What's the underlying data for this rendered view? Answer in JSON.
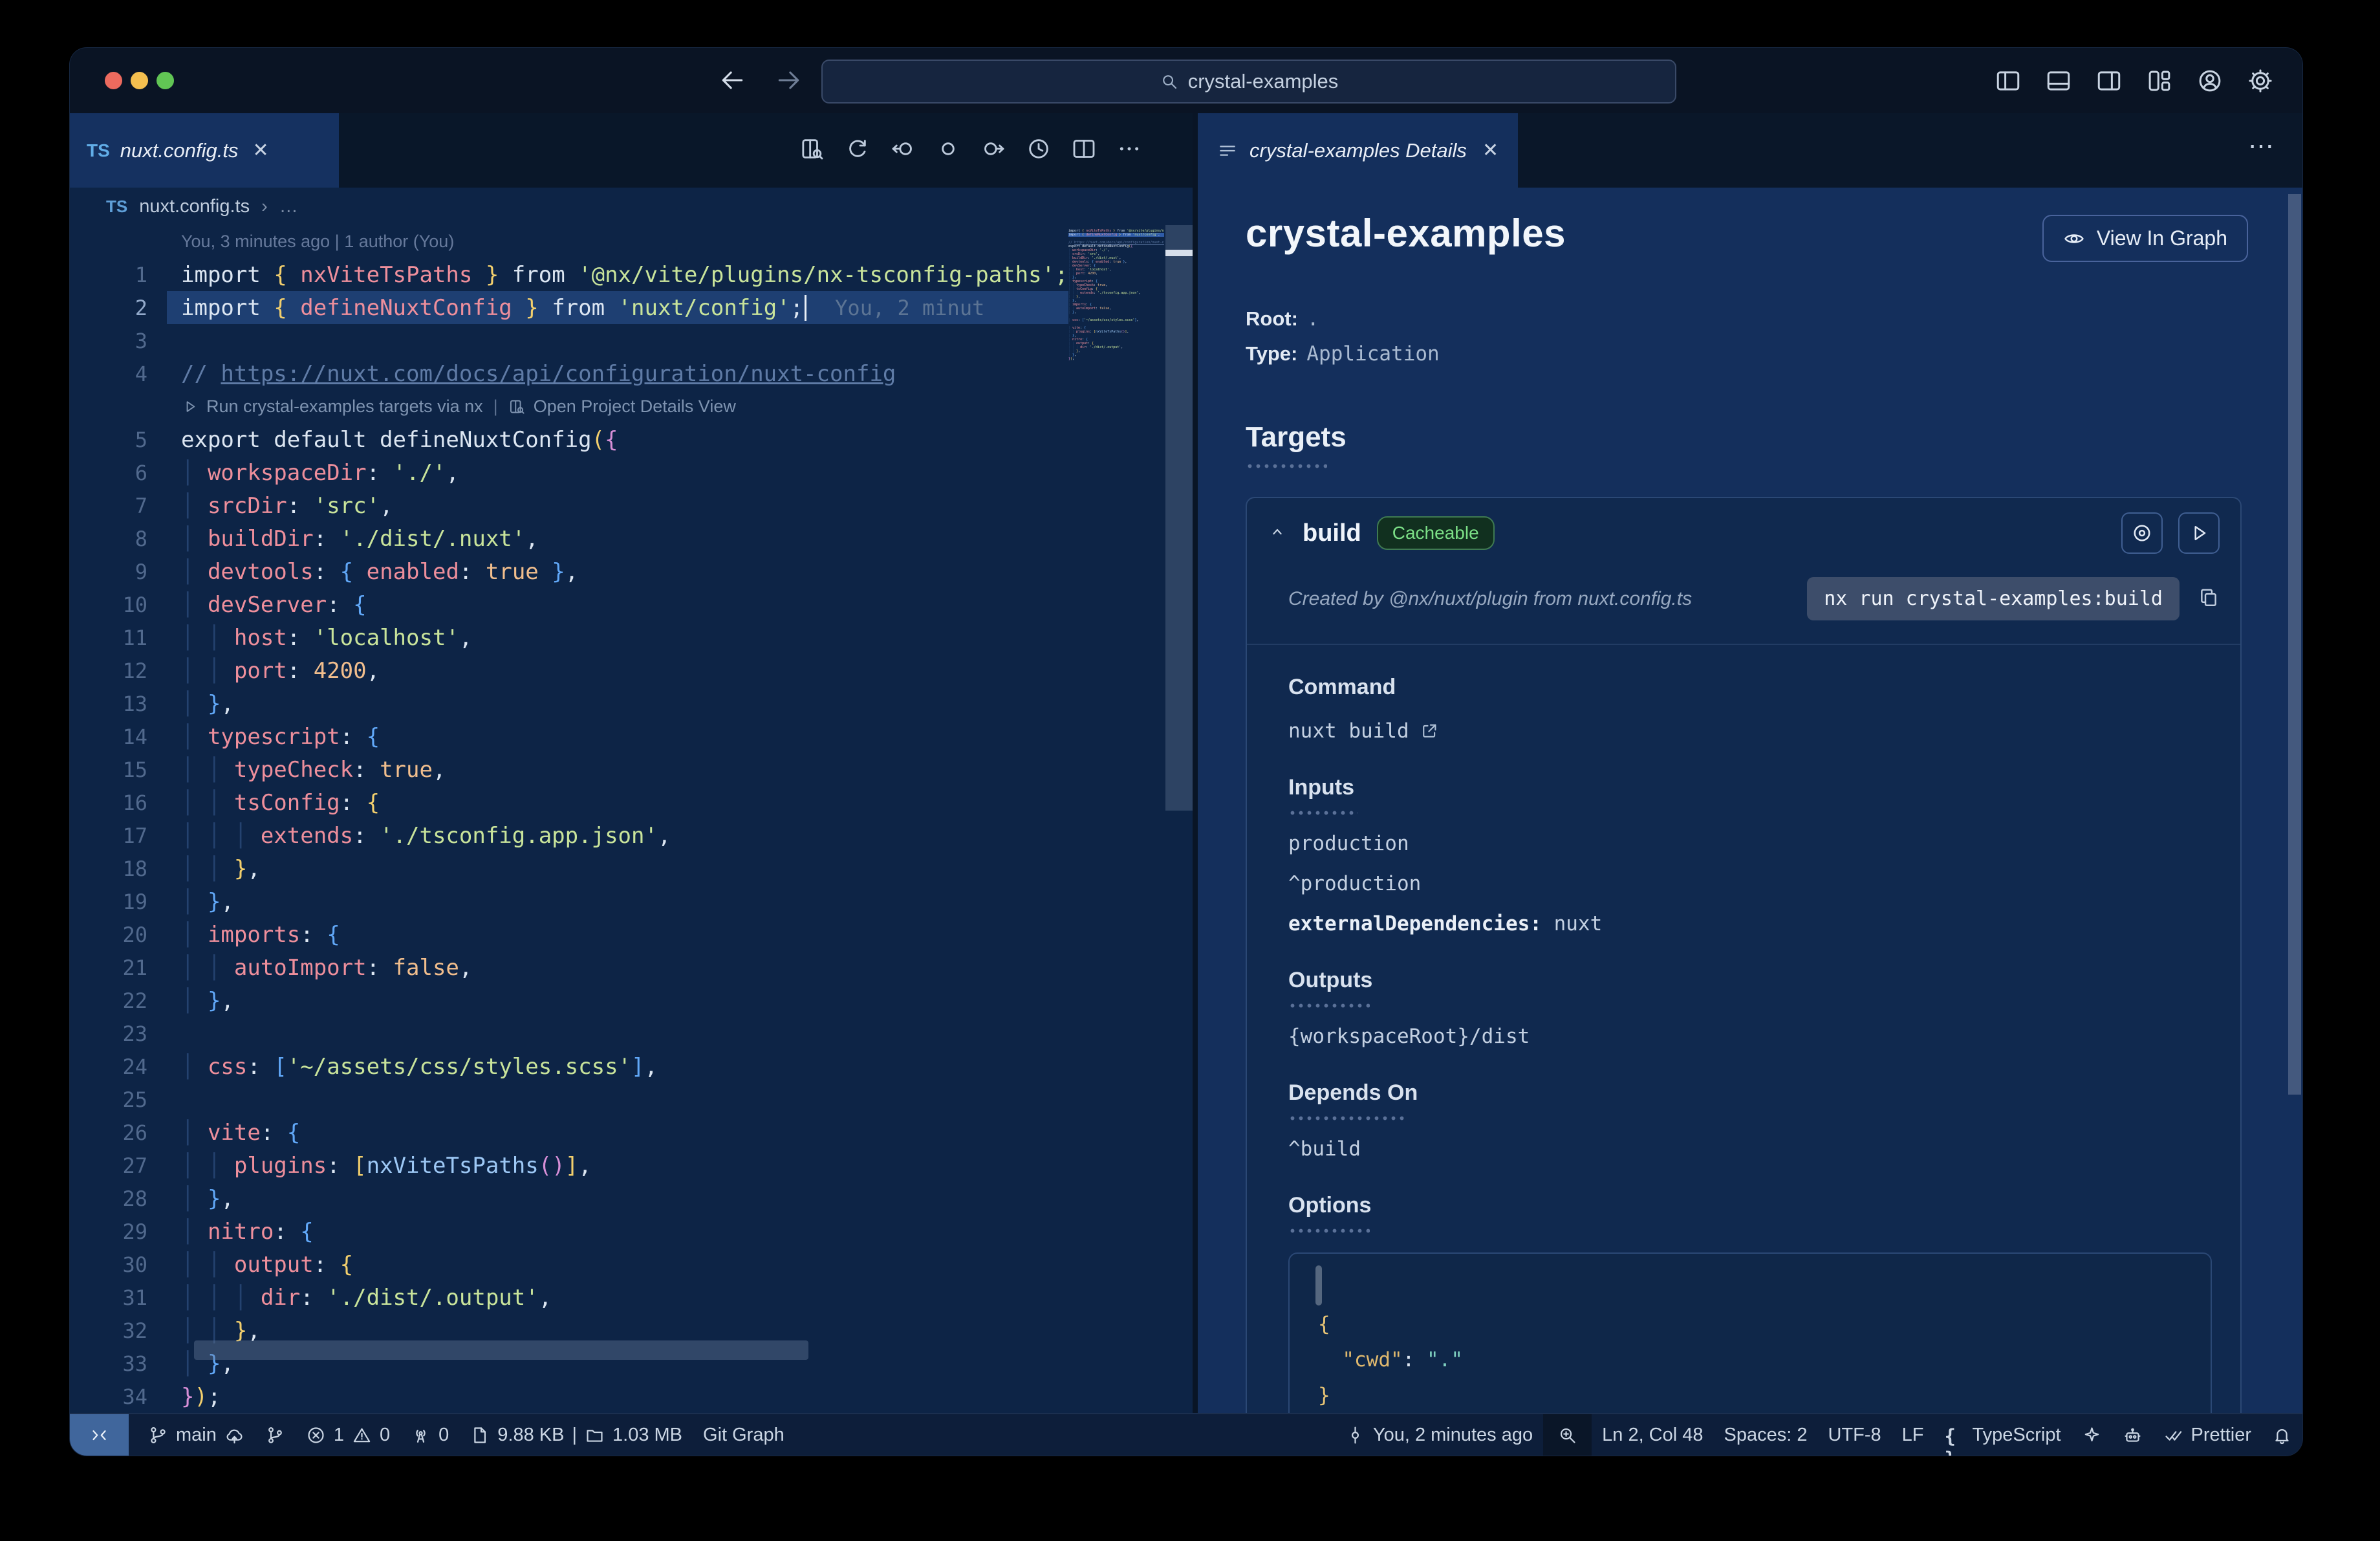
{
  "titlebar": {
    "search": "crystal-examples",
    "icons": [
      "layout-sidebar-left",
      "layout-panel",
      "layout-sidebar-right",
      "layout-grid",
      "account",
      "settings"
    ]
  },
  "editor": {
    "tab": {
      "lang": "TS",
      "name": "nuxt.config.ts",
      "close": "✕"
    },
    "actions": [
      "open-details",
      "refresh",
      "nav-back",
      "nav-dot",
      "nav-forward",
      "history",
      "split-editor",
      "more"
    ],
    "breadcrumb": {
      "lang": "TS",
      "file": "nuxt.config.ts",
      "sep": "›",
      "more": "…"
    },
    "blame": "You, 3 minutes ago | 1 author (You)",
    "codelens": {
      "run": "Run crystal-examples targets via nx",
      "sep": "|",
      "open": "Open Project Details View"
    },
    "ghost": "You, 2 minut",
    "lines": [
      {
        "n": 1,
        "s": [
          [
            "import ",
            "w"
          ],
          [
            "{",
            "b1"
          ],
          [
            " nxViteTsPaths ",
            "p"
          ],
          [
            "}",
            "b1"
          ],
          [
            " from ",
            "w"
          ],
          [
            "'@nx/vite/plugins/nx-tsconfig-paths';",
            "s"
          ]
        ]
      },
      {
        "n": 2,
        "s": [
          [
            "import ",
            "w"
          ],
          [
            "{",
            "b1"
          ],
          [
            " defineNuxtConfig ",
            "p"
          ],
          [
            "}",
            "b1"
          ],
          [
            " from ",
            "w"
          ],
          [
            "'nuxt/config'",
            "s"
          ],
          [
            ";",
            "w"
          ]
        ]
      },
      {
        "n": 3,
        "s": []
      },
      {
        "n": 4,
        "s": [
          [
            "// ",
            "c"
          ],
          [
            "https://nuxt.com/docs/api/configuration/nuxt-config",
            "cu"
          ]
        ]
      },
      {
        "n": 5,
        "s": [
          [
            "export default defineNuxtConfig",
            "w"
          ],
          [
            "(",
            "b1"
          ],
          [
            "{",
            "b2"
          ]
        ]
      },
      {
        "n": 6,
        "s": [
          [
            "│ ",
            "g"
          ],
          [
            "workspaceDir",
            "p"
          ],
          [
            ": ",
            "w"
          ],
          [
            "'./'",
            "s"
          ],
          [
            ",",
            "w"
          ]
        ]
      },
      {
        "n": 7,
        "s": [
          [
            "│ ",
            "g"
          ],
          [
            "srcDir",
            "p"
          ],
          [
            ": ",
            "w"
          ],
          [
            "'src'",
            "s"
          ],
          [
            ",",
            "w"
          ]
        ]
      },
      {
        "n": 8,
        "s": [
          [
            "│ ",
            "g"
          ],
          [
            "buildDir",
            "p"
          ],
          [
            ": ",
            "w"
          ],
          [
            "'./dist/.nuxt'",
            "s"
          ],
          [
            ",",
            "w"
          ]
        ]
      },
      {
        "n": 9,
        "s": [
          [
            "│ ",
            "g"
          ],
          [
            "devtools",
            "p"
          ],
          [
            ": ",
            "w"
          ],
          [
            "{",
            "b3"
          ],
          [
            " enabled",
            "p"
          ],
          [
            ": ",
            "w"
          ],
          [
            "true",
            "o"
          ],
          [
            " ",
            "w"
          ],
          [
            "}",
            "b3"
          ],
          [
            ",",
            "w"
          ]
        ]
      },
      {
        "n": 10,
        "s": [
          [
            "│ ",
            "g"
          ],
          [
            "devServer",
            "p"
          ],
          [
            ": ",
            "w"
          ],
          [
            "{",
            "b3"
          ]
        ]
      },
      {
        "n": 11,
        "s": [
          [
            "│ │ ",
            "g"
          ],
          [
            "host",
            "p"
          ],
          [
            ": ",
            "w"
          ],
          [
            "'localhost'",
            "s"
          ],
          [
            ",",
            "w"
          ]
        ]
      },
      {
        "n": 12,
        "s": [
          [
            "│ │ ",
            "g"
          ],
          [
            "port",
            "p"
          ],
          [
            ": ",
            "w"
          ],
          [
            "4200",
            "o"
          ],
          [
            ",",
            "w"
          ]
        ]
      },
      {
        "n": 13,
        "s": [
          [
            "│ ",
            "g"
          ],
          [
            "}",
            "b3"
          ],
          [
            ",",
            "w"
          ]
        ]
      },
      {
        "n": 14,
        "s": [
          [
            "│ ",
            "g"
          ],
          [
            "typescript",
            "p"
          ],
          [
            ": ",
            "w"
          ],
          [
            "{",
            "b3"
          ]
        ]
      },
      {
        "n": 15,
        "s": [
          [
            "│ │ ",
            "g"
          ],
          [
            "typeCheck",
            "p"
          ],
          [
            ": ",
            "w"
          ],
          [
            "true",
            "o"
          ],
          [
            ",",
            "w"
          ]
        ]
      },
      {
        "n": 16,
        "s": [
          [
            "│ │ ",
            "g"
          ],
          [
            "tsConfig",
            "p"
          ],
          [
            ": ",
            "w"
          ],
          [
            "{",
            "b1"
          ]
        ]
      },
      {
        "n": 17,
        "s": [
          [
            "│ │ │ ",
            "g"
          ],
          [
            "extends",
            "p"
          ],
          [
            ": ",
            "w"
          ],
          [
            "'./tsconfig.app.json'",
            "s"
          ],
          [
            ",",
            "w"
          ]
        ]
      },
      {
        "n": 18,
        "s": [
          [
            "│ │ ",
            "g"
          ],
          [
            "}",
            "b1"
          ],
          [
            ",",
            "w"
          ]
        ]
      },
      {
        "n": 19,
        "s": [
          [
            "│ ",
            "g"
          ],
          [
            "}",
            "b3"
          ],
          [
            ",",
            "w"
          ]
        ]
      },
      {
        "n": 20,
        "s": [
          [
            "│ ",
            "g"
          ],
          [
            "imports",
            "p"
          ],
          [
            ": ",
            "w"
          ],
          [
            "{",
            "b3"
          ]
        ]
      },
      {
        "n": 21,
        "s": [
          [
            "│ │ ",
            "g"
          ],
          [
            "autoImport",
            "p"
          ],
          [
            ": ",
            "w"
          ],
          [
            "false",
            "o"
          ],
          [
            ",",
            "w"
          ]
        ]
      },
      {
        "n": 22,
        "s": [
          [
            "│ ",
            "g"
          ],
          [
            "}",
            "b3"
          ],
          [
            ",",
            "w"
          ]
        ]
      },
      {
        "n": 23,
        "s": []
      },
      {
        "n": 24,
        "s": [
          [
            "│ ",
            "g"
          ],
          [
            "css",
            "p"
          ],
          [
            ": ",
            "w"
          ],
          [
            "[",
            "b3"
          ],
          [
            "'~/assets/css/styles.scss'",
            "s"
          ],
          [
            "]",
            "b3"
          ],
          [
            ",",
            "w"
          ]
        ]
      },
      {
        "n": 25,
        "s": []
      },
      {
        "n": 26,
        "s": [
          [
            "│ ",
            "g"
          ],
          [
            "vite",
            "p"
          ],
          [
            ": ",
            "w"
          ],
          [
            "{",
            "b3"
          ]
        ]
      },
      {
        "n": 27,
        "s": [
          [
            "│ │ ",
            "g"
          ],
          [
            "plugins",
            "p"
          ],
          [
            ": ",
            "w"
          ],
          [
            "[",
            "b1"
          ],
          [
            "nxViteTsPaths",
            "f"
          ],
          [
            "(",
            "b2"
          ],
          [
            ")",
            "b2"
          ],
          [
            "]",
            "b1"
          ],
          [
            ",",
            "w"
          ]
        ]
      },
      {
        "n": 28,
        "s": [
          [
            "│ ",
            "g"
          ],
          [
            "}",
            "b3"
          ],
          [
            ",",
            "w"
          ]
        ]
      },
      {
        "n": 29,
        "s": [
          [
            "│ ",
            "g"
          ],
          [
            "nitro",
            "p"
          ],
          [
            ": ",
            "w"
          ],
          [
            "{",
            "b3"
          ]
        ]
      },
      {
        "n": 30,
        "s": [
          [
            "│ │ ",
            "g"
          ],
          [
            "output",
            "p"
          ],
          [
            ": ",
            "w"
          ],
          [
            "{",
            "b1"
          ]
        ]
      },
      {
        "n": 31,
        "s": [
          [
            "│ │ │ ",
            "g"
          ],
          [
            "dir",
            "p"
          ],
          [
            ": ",
            "w"
          ],
          [
            "'./dist/.output'",
            "s"
          ],
          [
            ",",
            "w"
          ]
        ]
      },
      {
        "n": 32,
        "s": [
          [
            "│ │ ",
            "g"
          ],
          [
            "}",
            "b1"
          ],
          [
            ",",
            "w"
          ]
        ]
      },
      {
        "n": 33,
        "s": [
          [
            "│ ",
            "g"
          ],
          [
            "}",
            "b3"
          ],
          [
            ",",
            "w"
          ]
        ]
      },
      {
        "n": 34,
        "s": [
          [
            "}",
            "b2"
          ],
          [
            ")",
            "b1"
          ],
          [
            ";",
            "w"
          ]
        ]
      }
    ]
  },
  "panel": {
    "tab": {
      "title": "crystal-examples Details",
      "close": "✕"
    },
    "more": "⋯",
    "title": "crystal-examples",
    "view_in_graph": "View In Graph",
    "root_label": "Root:",
    "root_value": ".",
    "type_label": "Type:",
    "type_value": "Application",
    "targets_heading": "Targets",
    "build": {
      "name": "build",
      "badge": "Cacheable",
      "created": "Created by @nx/nuxt/plugin from nuxt.config.ts",
      "command_chip": "nx run crystal-examples:build",
      "command_heading": "Command",
      "command_value": "nuxt build",
      "inputs_heading": "Inputs",
      "inputs": [
        "production",
        "^production"
      ],
      "external_dep_label": "externalDependencies:",
      "external_dep_value": "nuxt",
      "outputs_heading": "Outputs",
      "outputs": [
        "{workspaceRoot}/dist"
      ],
      "depends_heading": "Depends On",
      "depends": [
        "^build"
      ],
      "options_heading": "Options",
      "options_lines": [
        [
          [
            "{",
            "jb"
          ]
        ],
        [
          [
            "  ",
            "w"
          ],
          [
            "\"cwd\"",
            "jk"
          ],
          [
            ":",
            "w"
          ],
          [
            " ",
            "w"
          ],
          [
            "\".\"",
            "jv"
          ]
        ],
        [
          [
            "}",
            "jb"
          ]
        ]
      ]
    }
  },
  "statusbar": {
    "left": [
      {
        "name": "remote-indicator",
        "cls": "remote",
        "parts": [
          {
            "i": "remote"
          }
        ]
      },
      {
        "name": "git-branch",
        "parts": [
          {
            "i": "branch"
          },
          {
            "t": "main"
          },
          {
            "i": "cloud"
          }
        ]
      },
      {
        "name": "source-control-graph",
        "parts": [
          {
            "i": "scgraph"
          }
        ]
      },
      {
        "name": "problems",
        "parts": [
          {
            "i": "error"
          },
          {
            "t": "1"
          },
          {
            "i": "warning"
          },
          {
            "t": "0"
          }
        ]
      },
      {
        "name": "ports",
        "parts": [
          {
            "i": "tower"
          },
          {
            "t": "0"
          }
        ]
      },
      {
        "name": "file-sizes",
        "parts": [
          {
            "i": "file"
          },
          {
            "t": "9.88 KB"
          },
          {
            "t": "|"
          },
          {
            "i": "folder"
          },
          {
            "t": "1.03 MB"
          }
        ]
      },
      {
        "name": "git-graph",
        "parts": [
          {
            "t": "Git Graph"
          }
        ]
      }
    ],
    "right": [
      {
        "name": "git-blame",
        "parts": [
          {
            "i": "commit"
          },
          {
            "t": "You, 2 minutes ago"
          }
        ]
      },
      {
        "name": "zoom-indicator",
        "cls": "dark",
        "parts": [
          {
            "i": "magnify"
          }
        ]
      },
      {
        "name": "cursor-position",
        "parts": [
          {
            "t": "Ln 2, Col 48"
          }
        ]
      },
      {
        "name": "indentation",
        "parts": [
          {
            "t": "Spaces: 2"
          }
        ]
      },
      {
        "name": "encoding",
        "parts": [
          {
            "t": "UTF-8"
          }
        ]
      },
      {
        "name": "eol",
        "parts": [
          {
            "t": "LF"
          }
        ]
      },
      {
        "name": "language-mode",
        "parts": [
          {
            "i": "braces"
          },
          {
            "t": "TypeScript"
          }
        ]
      },
      {
        "name": "extension-spark",
        "parts": [
          {
            "i": "spark"
          }
        ]
      },
      {
        "name": "copilot",
        "parts": [
          {
            "i": "robot"
          }
        ]
      },
      {
        "name": "prettier",
        "parts": [
          {
            "i": "dblcheck"
          },
          {
            "t": "Prettier"
          }
        ]
      },
      {
        "name": "notifications",
        "parts": [
          {
            "i": "bell"
          }
        ]
      }
    ]
  }
}
